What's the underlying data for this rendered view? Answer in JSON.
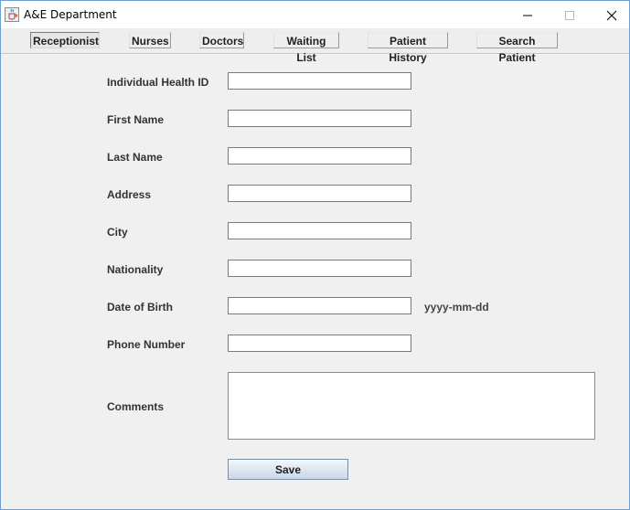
{
  "window": {
    "title": "A&E Department",
    "app_icon": "java-cup-icon",
    "controls": [
      "minimize-icon",
      "maximize-icon",
      "close-icon"
    ]
  },
  "tabs": [
    {
      "label": "Receptionist",
      "selected": true
    },
    {
      "label": "Nurses",
      "selected": false
    },
    {
      "label": "Doctors",
      "selected": false
    },
    {
      "label": "Waiting List",
      "selected": false
    },
    {
      "label": "Patient History",
      "selected": false
    },
    {
      "label": "Search Patient",
      "selected": false
    }
  ],
  "form": {
    "fields": [
      {
        "label": "Individual Health ID",
        "value": ""
      },
      {
        "label": "First Name",
        "value": ""
      },
      {
        "label": "Last Name",
        "value": ""
      },
      {
        "label": "Address",
        "value": ""
      },
      {
        "label": "City",
        "value": ""
      },
      {
        "label": "Nationality",
        "value": ""
      },
      {
        "label": "Date of Birth",
        "value": "",
        "hint": "yyyy-mm-dd"
      },
      {
        "label": "Phone Number",
        "value": ""
      }
    ],
    "comments": {
      "label": "Comments",
      "value": ""
    },
    "save_label": "Save"
  }
}
